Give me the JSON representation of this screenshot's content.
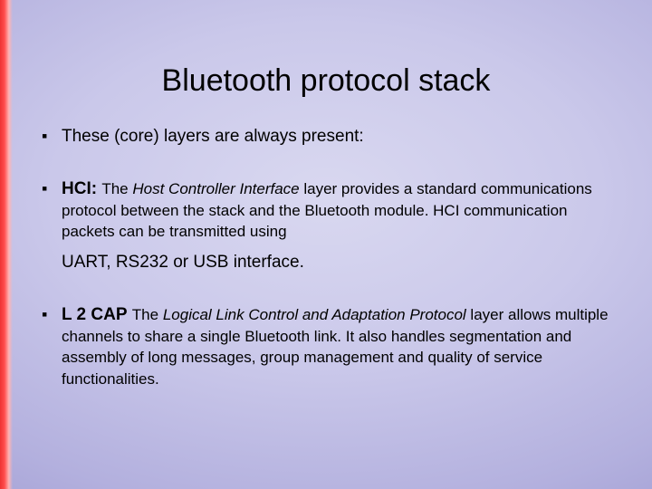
{
  "slide": {
    "title": "Bluetooth protocol stack",
    "bullets": [
      {
        "text": "These (core) layers are always present:"
      },
      {
        "lead_bold": "HCI:",
        "desc_start": "The ",
        "desc_italic": "Host Controller Interface",
        "desc_rest_1": " layer provides a standard communications protocol between the stack and the Bluetooth module. HCI communication packets can be transmitted using",
        "desc_rest_2": "UART, RS232 or USB interface."
      },
      {
        "lead_bold": "L 2 CAP",
        "desc_start": " The ",
        "desc_italic": "Logical Link Control and Adaptation Protocol",
        "desc_rest_1": " layer allows multiple channels to share a single Bluetooth link. It also handles segmentation and assembly of long messages, group management and quality of service functionalities."
      }
    ]
  }
}
